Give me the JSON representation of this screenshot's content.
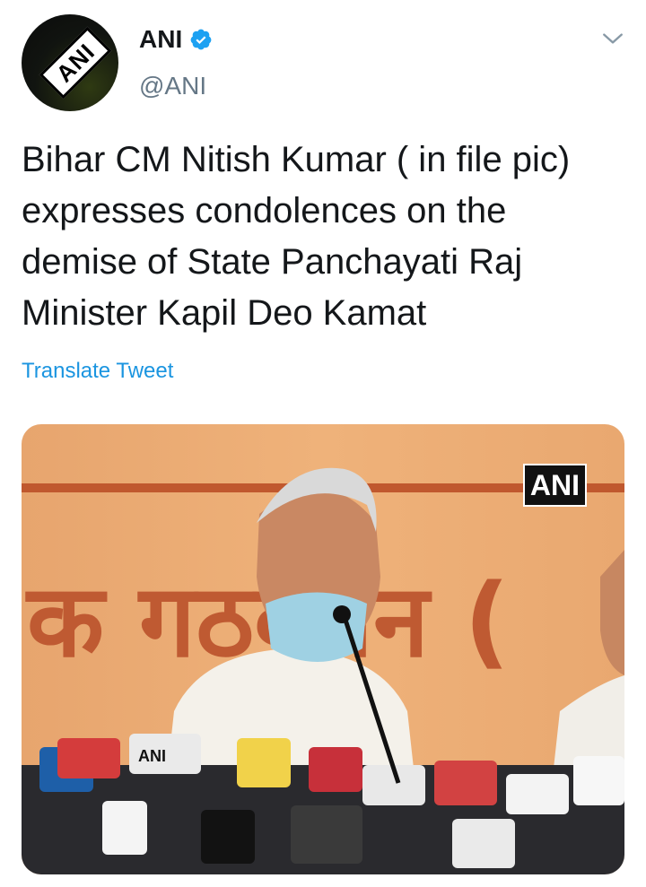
{
  "account": {
    "display_name": "ANI",
    "handle": "@ANI",
    "avatar_text": "ANI",
    "verified": true
  },
  "tweet": {
    "text": "Bihar CM Nitish Kumar ( in file pic) expresses condolences on the demise of State Panchayati Raj Minister Kapil Deo Kamat",
    "translate_label": "Translate Tweet"
  },
  "media": {
    "watermark": "ANI",
    "banner_text": "क गठबंधन ("
  },
  "colors": {
    "link": "#1b95e0",
    "verified": "#1da1f2",
    "handle": "#657786"
  },
  "icons": {
    "verified": "verified-badge-icon",
    "menu": "chevron-down-icon"
  }
}
